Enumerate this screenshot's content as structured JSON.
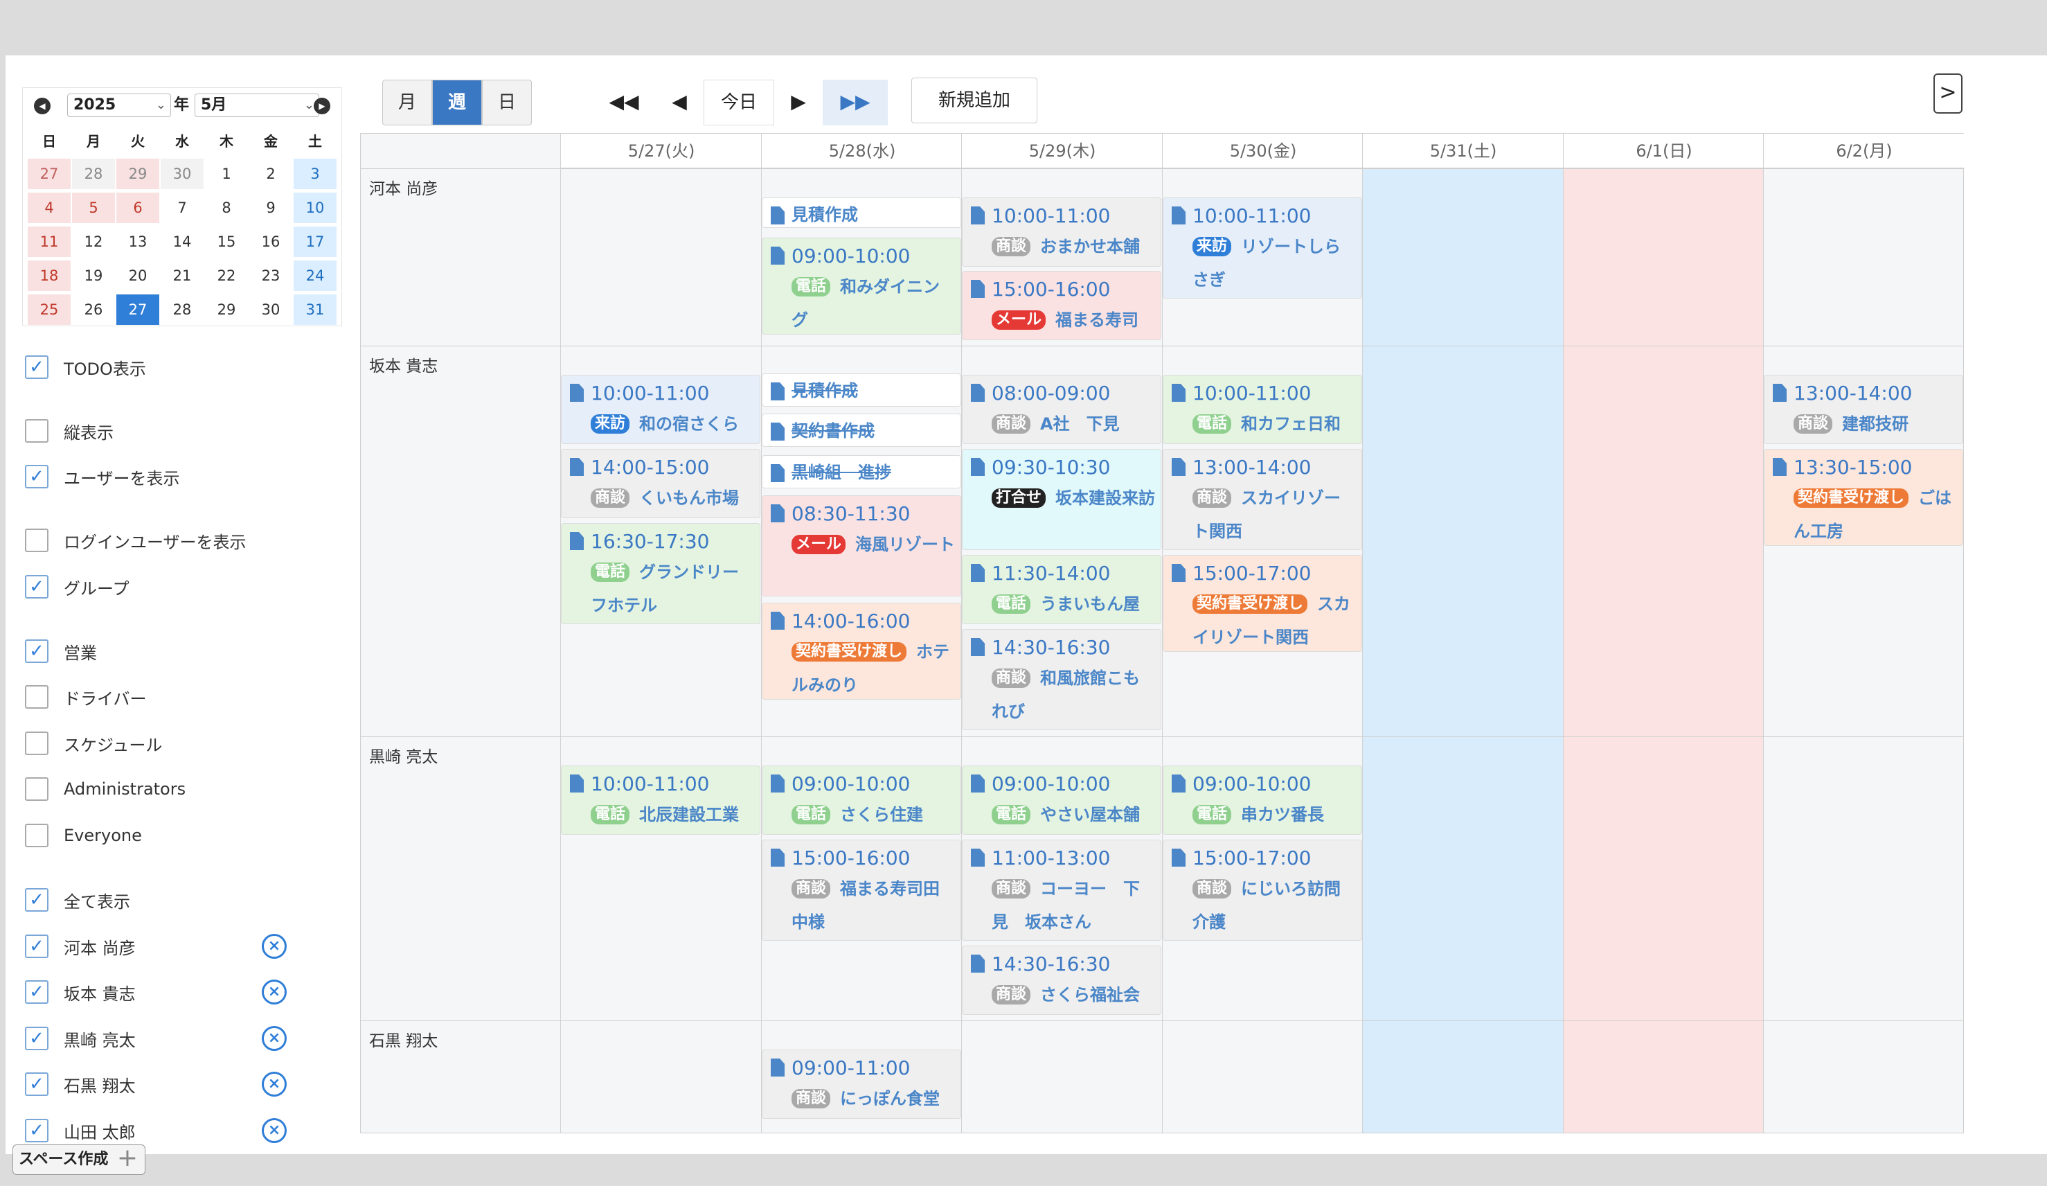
{
  "mini_calendar": {
    "year": "2025",
    "year_suffix": "年",
    "month": "5月",
    "dow": [
      "日",
      "月",
      "火",
      "水",
      "木",
      "金",
      "土"
    ],
    "rows": [
      [
        "27",
        "28",
        "29",
        "30",
        "1",
        "2",
        "3"
      ],
      [
        "4",
        "5",
        "6",
        "7",
        "8",
        "9",
        "10"
      ],
      [
        "11",
        "12",
        "13",
        "14",
        "15",
        "16",
        "17"
      ],
      [
        "18",
        "19",
        "20",
        "21",
        "22",
        "23",
        "24"
      ],
      [
        "25",
        "26",
        "27",
        "28",
        "29",
        "30",
        "31"
      ]
    ]
  },
  "options": {
    "todo": "TODO表示",
    "vertical": "縦表示",
    "show_users": "ユーザーを表示",
    "show_login_user": "ログインユーザーを表示",
    "group": "グループ"
  },
  "groups": [
    "営業",
    "ドライバー",
    "スケジュール",
    "Administrators",
    "Everyone"
  ],
  "show_all": "全て表示",
  "users": [
    "河本 尚彦",
    "坂本 貴志",
    "黒崎 亮太",
    "石黒 翔太",
    "山田 太郎"
  ],
  "space_button": "スペース作成",
  "toolbar": {
    "month": "月",
    "week": "週",
    "day": "日",
    "today": "今日",
    "new": "新規追加",
    "toggle": ">"
  },
  "columns": [
    "5/27(火)",
    "5/28(水)",
    "5/29(木)",
    "5/30(金)",
    "5/31(土)",
    "6/1(日)",
    "6/2(月)"
  ],
  "tags": {
    "shodan": "商談",
    "denwa": "電話",
    "raiho": "来訪",
    "mail": "メール",
    "keiyaku": "契約書受け渡し",
    "uchiawase": "打合せ"
  },
  "events": {
    "r1": {
      "todo1": "見積作成",
      "e1": {
        "time": "09:00-10:00",
        "desc": "和みダイニング"
      },
      "e2": {
        "time": "10:00-11:00",
        "desc": "おまかせ本舗"
      },
      "e3": {
        "time": "15:00-16:00",
        "desc": "福まる寿司"
      },
      "e4": {
        "time": "10:00-11:00",
        "desc": "リゾートしらさぎ"
      }
    },
    "r2": {
      "e1": {
        "time": "10:00-11:00",
        "desc": "和の宿さくら"
      },
      "e2": {
        "time": "14:00-15:00",
        "desc": "くいもん市場"
      },
      "e3": {
        "time": "16:30-17:30",
        "desc": "グランドリーフホテル"
      },
      "todo1": "見積作成",
      "todo2": "契約書作成",
      "todo3": "黒崎組　進捗",
      "e4": {
        "time": "08:30-11:30",
        "desc": "海風リゾート"
      },
      "e5": {
        "time": "14:00-16:00",
        "desc": "ホテルみのり"
      },
      "e6": {
        "time": "08:00-09:00",
        "desc": "A社　下見"
      },
      "e7": {
        "time": "09:30-10:30",
        "desc": "坂本建設来訪"
      },
      "e8": {
        "time": "11:30-14:00",
        "desc": "うまいもん屋"
      },
      "e9": {
        "time": "14:30-16:30",
        "desc": "和風旅館こもれび"
      },
      "e10": {
        "time": "10:00-11:00",
        "desc": "和カフェ日和"
      },
      "e11": {
        "time": "13:00-14:00",
        "desc": "スカイリゾート関西"
      },
      "e12": {
        "time": "15:00-17:00",
        "desc": "スカイリゾート関西"
      },
      "e13": {
        "time": "13:00-14:00",
        "desc": "建都技研"
      },
      "e14": {
        "time": "13:30-15:00",
        "desc": "ごはん工房"
      }
    },
    "r3": {
      "e1": {
        "time": "10:00-11:00",
        "desc": "北辰建設工業"
      },
      "e2": {
        "time": "09:00-10:00",
        "desc": "さくら住建"
      },
      "e3": {
        "time": "15:00-16:00",
        "desc": "福まる寿司田中様"
      },
      "e4": {
        "time": "09:00-10:00",
        "desc": "やさい屋本舗"
      },
      "e5": {
        "time": "11:00-13:00",
        "desc": "コーヨー　下見　坂本さん"
      },
      "e6": {
        "time": "14:30-16:30",
        "desc": "さくら福祉会"
      },
      "e7": {
        "time": "09:00-10:00",
        "desc": "串カツ番長"
      },
      "e8": {
        "time": "15:00-17:00",
        "desc": "にじいろ訪問介護"
      }
    },
    "r4": {
      "e1": {
        "time": "09:00-11:00",
        "desc": "にっぽん食堂"
      }
    }
  }
}
